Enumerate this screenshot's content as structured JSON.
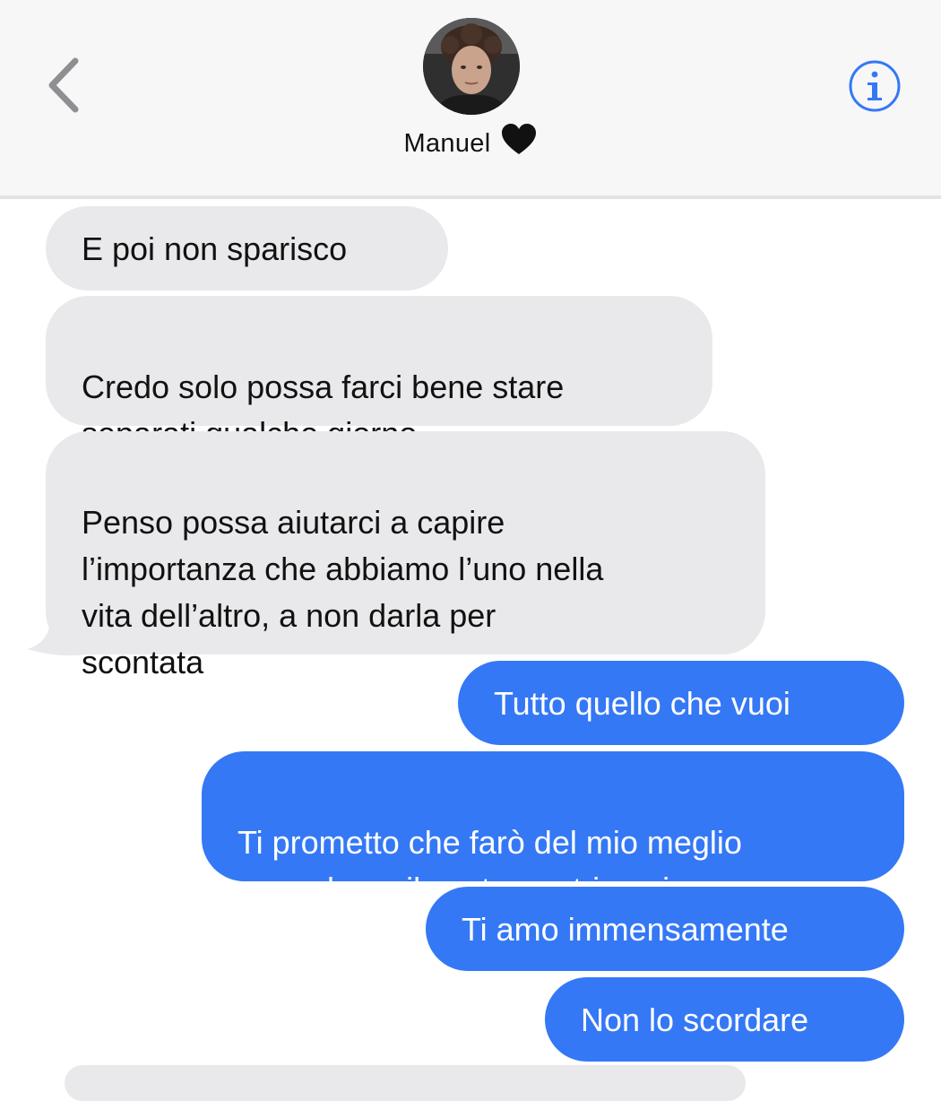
{
  "header": {
    "contact_name": "Manuel",
    "name_emoji": "black-heart-icon",
    "back_icon": "chevron-left-icon",
    "info_icon": "info-icon",
    "accent_color": "#3478f6"
  },
  "messages": [
    {
      "direction": "incoming",
      "text": "E poi non sparisco"
    },
    {
      "direction": "incoming",
      "text": "Credo solo possa farci bene stare\nseparati qualche giorno"
    },
    {
      "direction": "incoming",
      "text": "Penso possa aiutarci a capire\nl’importanza che abbiamo l’uno nella\nvita dell’altro, a non darla per\nscontata"
    },
    {
      "direction": "outgoing",
      "text": "Tutto quello che vuoi"
    },
    {
      "direction": "outgoing",
      "text": "Ti prometto che farò del mio meglio\nper salvare il nostro matrimonio"
    },
    {
      "direction": "outgoing",
      "text": "Ti amo immensamente"
    },
    {
      "direction": "outgoing",
      "text": "Non lo scordare"
    }
  ],
  "colors": {
    "incoming_bubble": "#e9e9eb",
    "outgoing_bubble": "#3478f6"
  }
}
